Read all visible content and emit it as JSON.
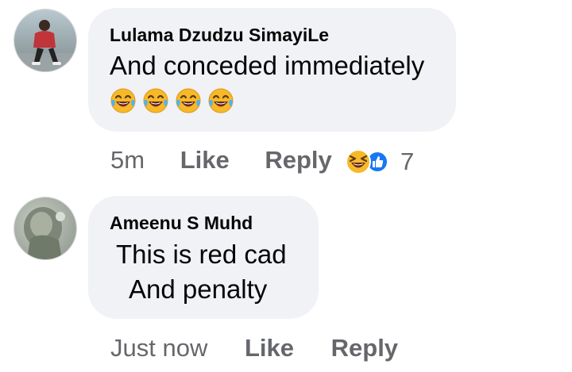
{
  "comments": [
    {
      "author": "Lulama Dzudzu SimayiLe",
      "text_line1": "And conceded immediately",
      "emoji_icons": [
        "face-with-tears-of-joy-icon",
        "face-with-tears-of-joy-icon",
        "face-with-tears-of-joy-icon",
        "face-with-tears-of-joy-icon"
      ],
      "time": "5m",
      "like_label": "Like",
      "reply_label": "Reply",
      "reaction_icons": [
        "laughing-reaction-icon",
        "like-reaction-icon"
      ],
      "reaction_count": "7"
    },
    {
      "author": "Ameenu S Muhd",
      "text_line1": "This is red cad",
      "text_line2": "And penalty",
      "time": "Just now",
      "like_label": "Like",
      "reply_label": "Reply"
    }
  ],
  "colors": {
    "bubble_bg": "#f0f2f5",
    "text": "#050505",
    "meta": "#65676b",
    "like_blue": "#1877f2",
    "emoji_yellow": "#f7b928"
  }
}
